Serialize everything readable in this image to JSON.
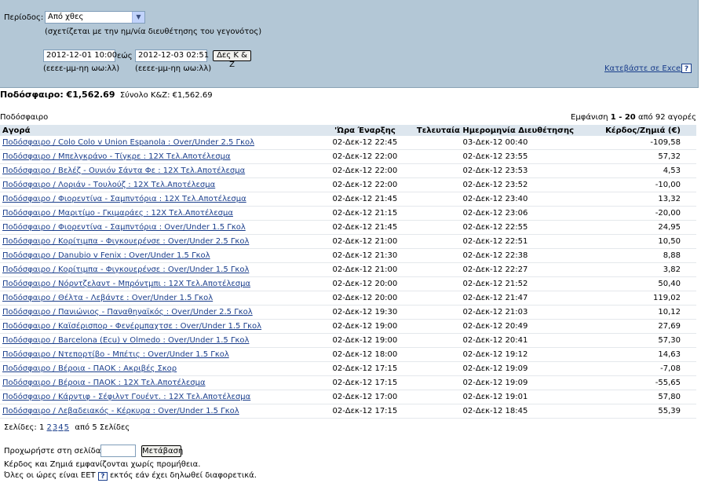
{
  "filter": {
    "period_label": "Περίοδος:",
    "period_value": "Από χθες",
    "period_note": "(σχετίζεται με την ημ/νία διευθέτησης του γεγονότος)",
    "from_date": "2012-12-01 10:00",
    "to_label": "εώς",
    "to_date": "2012-12-03 02:51",
    "show_button": "Δες Κ & Ζ",
    "from_format": "(εεεε-μμ-ηη ωω:λλ)",
    "to_format": "(εεεε-μμ-ηη ωω:λλ)",
    "excel_link": "Κατεβάστε σε Excel",
    "help_glyph": "?"
  },
  "summary": {
    "sport_total_label": "Ποδόσφαιρο: €1,562.69",
    "grand_total_label": "Σύνολο Κ&Ζ:",
    "grand_total_value": "€1,562.69"
  },
  "table": {
    "section_title": "Ποδόσφαιρο",
    "showing_prefix": "Εμφάνιση",
    "showing_range": "1 - 20",
    "showing_suffix": "από 92 αγορές",
    "headers": [
      "Αγορά",
      "'Ώρα Έναρξης",
      "Τελευταία Ημερομηνία Διευθέτησης",
      "Κέρδος/Ζημιά (€)"
    ],
    "rows": [
      {
        "market": "Ποδόσφαιρο / Colo Colo v Union Espanola : Over/Under 2.5 Γκολ",
        "start": "02-Δεκ-12 22:45",
        "settled": "03-Δεκ-12 00:40",
        "pl": "-109,58"
      },
      {
        "market": "Ποδόσφαιρο / Μπελγκράνο - Τίγκρε : 12Χ Τελ.Αποτέλεσμα",
        "start": "02-Δεκ-12 22:00",
        "settled": "02-Δεκ-12 23:55",
        "pl": "57,32"
      },
      {
        "market": "Ποδόσφαιρο / Βελέζ - Ουνιόν Σάντα Φε : 12Χ Τελ.Αποτέλεσμα",
        "start": "02-Δεκ-12 22:00",
        "settled": "02-Δεκ-12 23:53",
        "pl": "4,53"
      },
      {
        "market": "Ποδόσφαιρο / Λοριάν - Τουλούζ : 12Χ Τελ.Αποτέλεσμα",
        "start": "02-Δεκ-12 22:00",
        "settled": "02-Δεκ-12 23:52",
        "pl": "-10,00"
      },
      {
        "market": "Ποδόσφαιρο / Φιορεντίνα - Σαμπντόρια : 12Χ Τελ.Αποτέλεσμα",
        "start": "02-Δεκ-12 21:45",
        "settled": "02-Δεκ-12 23:40",
        "pl": "13,32"
      },
      {
        "market": "Ποδόσφαιρο / Μαριτίμο - Γκιμαράες : 12Χ Τελ.Αποτέλεσμα",
        "start": "02-Δεκ-12 21:15",
        "settled": "02-Δεκ-12 23:06",
        "pl": "-20,00"
      },
      {
        "market": "Ποδόσφαιρο / Φιορεντίνα - Σαμπντόρια : Over/Under 1.5 Γκολ",
        "start": "02-Δεκ-12 21:45",
        "settled": "02-Δεκ-12 22:55",
        "pl": "24,95"
      },
      {
        "market": "Ποδόσφαιρο / Κορίτιμπα - Φιγκουερένσε : Over/Under 2.5 Γκολ",
        "start": "02-Δεκ-12 21:00",
        "settled": "02-Δεκ-12 22:51",
        "pl": "10,50"
      },
      {
        "market": "Ποδόσφαιρο / Danubio v Fenix : Over/Under 1.5 Γκολ",
        "start": "02-Δεκ-12 21:30",
        "settled": "02-Δεκ-12 22:38",
        "pl": "8,88"
      },
      {
        "market": "Ποδόσφαιρο / Κορίτιμπα - Φιγκουερένσε : Over/Under 1.5 Γκολ",
        "start": "02-Δεκ-12 21:00",
        "settled": "02-Δεκ-12 22:27",
        "pl": "3,82"
      },
      {
        "market": "Ποδόσφαιρο / Νόρντζελαντ - Μπρόντμπι : 12Χ Τελ.Αποτέλεσμα",
        "start": "02-Δεκ-12 20:00",
        "settled": "02-Δεκ-12 21:52",
        "pl": "50,40"
      },
      {
        "market": "Ποδόσφαιρο / Θέλτα - Λεβάντε : Over/Under 1.5 Γκολ",
        "start": "02-Δεκ-12 20:00",
        "settled": "02-Δεκ-12 21:47",
        "pl": "119,02"
      },
      {
        "market": "Ποδόσφαιρο / Πανιώνιος - Παναθηναϊκός : Over/Under 2.5 Γκολ",
        "start": "02-Δεκ-12 19:30",
        "settled": "02-Δεκ-12 21:03",
        "pl": "10,12"
      },
      {
        "market": "Ποδόσφαιρο / Καϊσέρισπορ - Φενέρμπαχτσε : Over/Under 1.5 Γκολ",
        "start": "02-Δεκ-12 19:00",
        "settled": "02-Δεκ-12 20:49",
        "pl": "27,69"
      },
      {
        "market": "Ποδόσφαιρο / Barcelona (Ecu) v Olmedo : Over/Under 1.5 Γκολ",
        "start": "02-Δεκ-12 19:00",
        "settled": "02-Δεκ-12 20:41",
        "pl": "57,30"
      },
      {
        "market": "Ποδόσφαιρο / Ντεπορτίβο - Μπέτις : Over/Under 1.5 Γκολ",
        "start": "02-Δεκ-12 18:00",
        "settled": "02-Δεκ-12 19:12",
        "pl": "14,63"
      },
      {
        "market": "Ποδόσφαιρο / Βέροια - ΠΑΟΚ : Ακριβές Σκορ",
        "start": "02-Δεκ-12 17:15",
        "settled": "02-Δεκ-12 19:09",
        "pl": "-7,08"
      },
      {
        "market": "Ποδόσφαιρο / Βέροια - ΠΑΟΚ : 12Χ Τελ.Αποτέλεσμα",
        "start": "02-Δεκ-12 17:15",
        "settled": "02-Δεκ-12 19:09",
        "pl": "-55,65"
      },
      {
        "market": "Ποδόσφαιρο / Κάρντιφ - Σέφιλντ Γουέντ. : 12Χ Τελ.Αποτέλεσμα",
        "start": "02-Δεκ-12 17:00",
        "settled": "02-Δεκ-12 19:01",
        "pl": "57,80"
      },
      {
        "market": "Ποδόσφαιρο / Λεβαδειακός - Κέρκυρα : Over/Under 1.5 Γκολ",
        "start": "02-Δεκ-12 17:15",
        "settled": "02-Δεκ-12 18:45",
        "pl": "55,39"
      }
    ]
  },
  "pagination": {
    "label": "Σελίδες:",
    "current": "1",
    "pages": [
      "2",
      "3",
      "4",
      "5"
    ],
    "suffix": "από 5 Σελίδες",
    "goto_label": "Προχωρήστε στη σελίδα:",
    "goto_button": "Μετάβαση"
  },
  "footer": {
    "note1": "Κέρδος και Ζημιά εμφανίζονται χωρίς προμήθεια.",
    "note2_prefix": "Όλες οι ώρες είναι EET",
    "note2_suffix": "εκτός εάν έχει δηλωθεί διαφορετικά."
  },
  "colors": {
    "filter_bg": "#b3c7d6",
    "header_bg": "#dde6ee",
    "link": "#1a3e8c"
  }
}
